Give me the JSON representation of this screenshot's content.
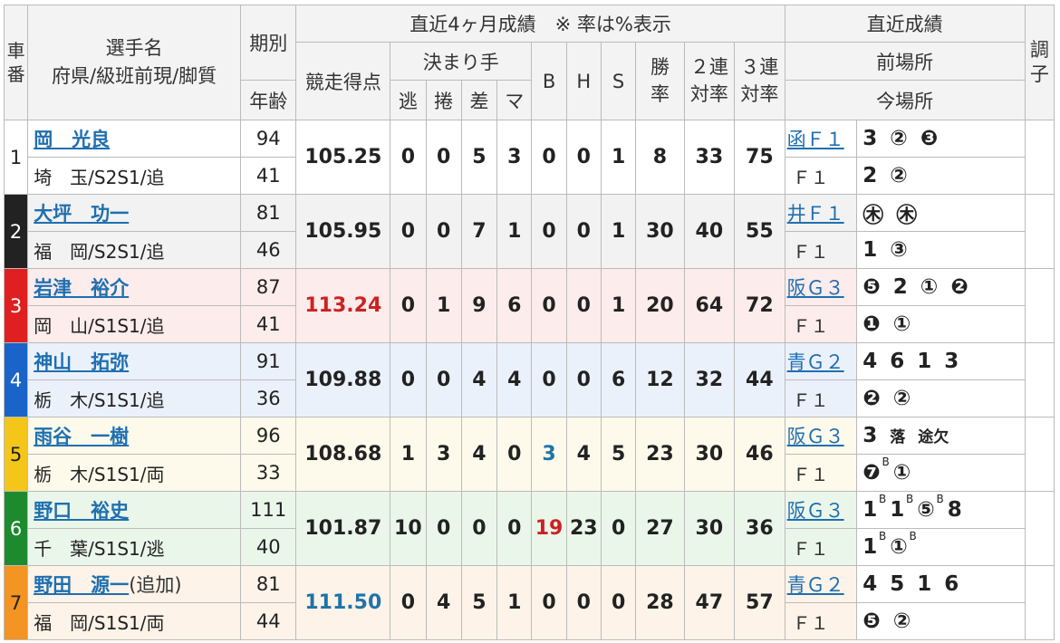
{
  "headers": {
    "car": "車番",
    "name_l1": "選手名",
    "name_l2": "府県/級班前現/脚質",
    "kibetsu": "期別",
    "age": "年齢",
    "recent_4m": "直近4ヶ月成績　※ 率は%表示",
    "score": "競走得点",
    "kimarite": "決まり手",
    "nige": "逃",
    "makuri": "捲",
    "sashi": "差",
    "ma": "マ",
    "b": "B",
    "h": "H",
    "s": "S",
    "win_rate": "勝率",
    "ren2": "２連対率",
    "ren3": "３連対率",
    "recent_results": "直近成績",
    "prev_venue": "前場所",
    "this_venue": "今場所",
    "condition": "調子"
  },
  "riders": [
    {
      "car": "1",
      "name": "岡　光良",
      "extra": "",
      "pref": "埼　玉/S2S1/追",
      "kibetsu": "94",
      "age": "41",
      "score": "105.25",
      "score_color": "",
      "nige": "0",
      "makuri": "0",
      "sashi": "5",
      "ma": "3",
      "b": "0",
      "h": "0",
      "s": "1",
      "b_color": "",
      "h_color": "",
      "win": "8",
      "ren2": "33",
      "ren3": "75",
      "prev_venue": "函Ｆ１",
      "prev_results": [
        "3",
        "②",
        "❸"
      ],
      "this_venue": "Ｆ１",
      "this_results": [
        "2",
        "②"
      ]
    },
    {
      "car": "2",
      "name": "大坪　功一",
      "extra": "",
      "pref": "福　岡/S2S1/追",
      "kibetsu": "81",
      "age": "46",
      "score": "105.95",
      "score_color": "",
      "nige": "0",
      "makuri": "0",
      "sashi": "7",
      "ma": "1",
      "b": "0",
      "h": "0",
      "s": "1",
      "b_color": "",
      "h_color": "",
      "win": "30",
      "ren2": "40",
      "ren3": "55",
      "prev_venue": "井Ｆ１",
      "prev_results": [
        "㊍",
        "㊍"
      ],
      "this_venue": "Ｆ１",
      "this_results": [
        "1",
        "③"
      ]
    },
    {
      "car": "3",
      "name": "岩津　裕介",
      "extra": "",
      "pref": "岡　山/S1S1/追",
      "kibetsu": "87",
      "age": "41",
      "score": "113.24",
      "score_color": "red",
      "nige": "0",
      "makuri": "1",
      "sashi": "9",
      "ma": "6",
      "b": "0",
      "h": "0",
      "s": "1",
      "b_color": "",
      "h_color": "",
      "win": "20",
      "ren2": "64",
      "ren3": "72",
      "prev_venue": "阪Ｇ３",
      "prev_results": [
        "❺",
        "2",
        "①",
        "❷"
      ],
      "this_venue": "Ｆ１",
      "this_results": [
        "❶",
        "①"
      ]
    },
    {
      "car": "4",
      "name": "神山　拓弥",
      "extra": "",
      "pref": "栃　木/S1S1/追",
      "kibetsu": "91",
      "age": "36",
      "score": "109.88",
      "score_color": "",
      "nige": "0",
      "makuri": "0",
      "sashi": "4",
      "ma": "4",
      "b": "0",
      "h": "0",
      "s": "6",
      "b_color": "",
      "h_color": "",
      "win": "12",
      "ren2": "32",
      "ren3": "44",
      "prev_venue": "青Ｇ２",
      "prev_results": [
        "4",
        "6",
        "1",
        "3"
      ],
      "this_venue": "Ｆ１",
      "this_results": [
        "❷",
        "②"
      ]
    },
    {
      "car": "5",
      "name": "雨谷　一樹",
      "extra": "",
      "pref": "栃　木/S1S1/両",
      "kibetsu": "96",
      "age": "33",
      "score": "108.68",
      "score_color": "",
      "nige": "1",
      "makuri": "3",
      "sashi": "4",
      "ma": "0",
      "b": "3",
      "h": "4",
      "s": "5",
      "b_color": "blue",
      "h_color": "",
      "win": "23",
      "ren2": "30",
      "ren3": "46",
      "prev_venue": "阪Ｇ３",
      "prev_results": [
        "3",
        "落",
        "途欠"
      ],
      "this_venue": "Ｆ１",
      "this_results": [
        "❼",
        "①"
      ]
    },
    {
      "car": "6",
      "name": "野口　裕史",
      "extra": "",
      "pref": "千　葉/S1S1/逃",
      "kibetsu": "111",
      "age": "40",
      "score": "101.87",
      "score_color": "",
      "nige": "10",
      "makuri": "0",
      "sashi": "0",
      "ma": "0",
      "b": "19",
      "h": "23",
      "s": "0",
      "b_color": "red",
      "h_color": "",
      "win": "27",
      "ren2": "30",
      "ren3": "36",
      "prev_venue": "阪Ｇ３",
      "prev_results": [
        "1",
        "1",
        "⑤",
        "8"
      ],
      "this_venue": "Ｆ１",
      "this_results": [
        "1",
        "①"
      ]
    },
    {
      "car": "7",
      "name": "野田　源一",
      "extra": "(追加)",
      "pref": "福　岡/S1S1/両",
      "kibetsu": "81",
      "age": "44",
      "score": "111.50",
      "score_color": "blue",
      "nige": "0",
      "makuri": "4",
      "sashi": "5",
      "ma": "1",
      "b": "0",
      "h": "0",
      "s": "0",
      "b_color": "",
      "h_color": "",
      "win": "28",
      "ren2": "47",
      "ren3": "57",
      "prev_venue": "青Ｇ２",
      "prev_results": [
        "4",
        "5",
        "1",
        "6"
      ],
      "this_venue": "Ｆ１",
      "this_results": [
        "❺",
        "②"
      ]
    }
  ],
  "superscripts": {
    "b_mark": "B"
  }
}
